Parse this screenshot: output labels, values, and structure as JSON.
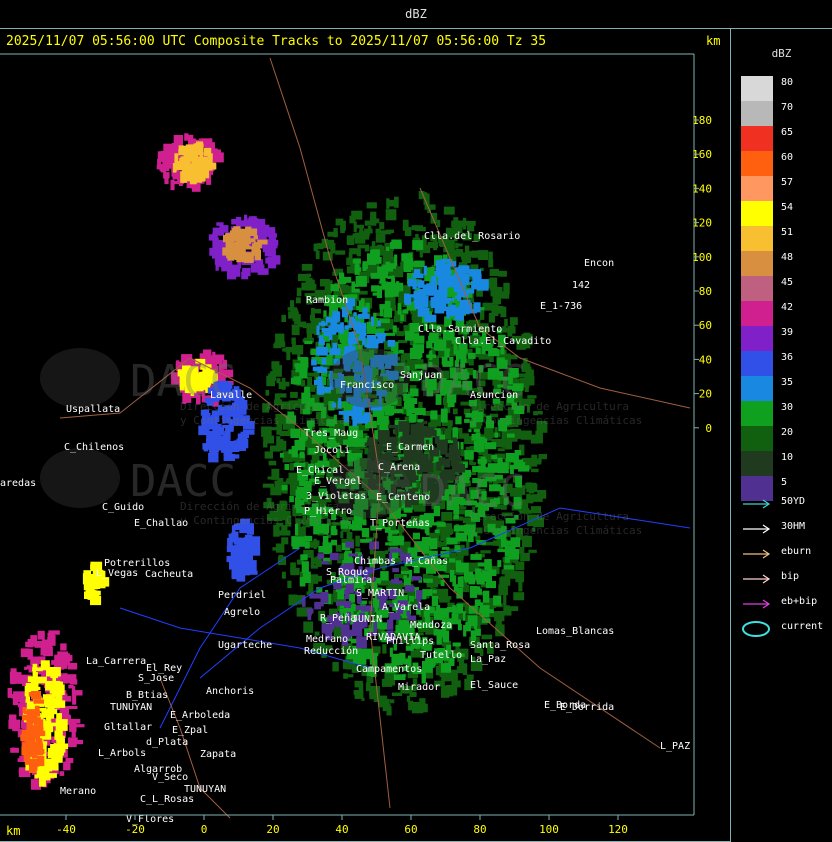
{
  "top_title": "dBZ",
  "header": "2025/11/07 05:56:00 UTC Composite Tracks to 2025/11/07 05:56:00 Tz 35",
  "km_label": "km",
  "y_axis_ticks": [
    "180",
    "160",
    "140",
    "120",
    "100",
    "80",
    "60",
    "40",
    "20",
    "0"
  ],
  "x_axis_ticks": [
    "-40",
    "-20",
    "0",
    "20",
    "40",
    "60",
    "80",
    "100",
    "120"
  ],
  "colorbar": {
    "title": "dBZ",
    "bins": [
      {
        "label": "80",
        "color": "#d8d8d8"
      },
      {
        "label": "70",
        "color": "#b8b8b8"
      },
      {
        "label": "65",
        "color": "#f03020"
      },
      {
        "label": "60",
        "color": "#ff6010"
      },
      {
        "label": "57",
        "color": "#ff9860"
      },
      {
        "label": "54",
        "color": "#ffff00"
      },
      {
        "label": "51",
        "color": "#f8c030"
      },
      {
        "label": "48",
        "color": "#d89040"
      },
      {
        "label": "45",
        "color": "#c06080"
      },
      {
        "label": "42",
        "color": "#d02090"
      },
      {
        "label": "39",
        "color": "#8020c8"
      },
      {
        "label": "36",
        "color": "#3050e8"
      },
      {
        "label": "35",
        "color": "#1888e0"
      },
      {
        "label": "30",
        "color": "#10a020"
      },
      {
        "label": "20",
        "color": "#106010"
      },
      {
        "label": "10",
        "color": "#203a20"
      },
      {
        "label": "5",
        "color": "#503090"
      }
    ]
  },
  "legend": [
    {
      "label": "50YD",
      "color": "#40d0d0"
    },
    {
      "label": "30HM",
      "color": "#ffffff"
    },
    {
      "label": "eburn",
      "color": "#f0c080"
    },
    {
      "label": "bip",
      "color": "#ffd0d0"
    },
    {
      "label": "eb+bip",
      "color": "#e040e0"
    },
    {
      "label": "current",
      "color": "#40e0e0"
    }
  ],
  "watermark": {
    "brand": "DACC",
    "line1": "Dirección de Agricultura",
    "line2": "y Contingencias Climáticas"
  },
  "places": [
    {
      "name": "Clla.del_Rosario"
    },
    {
      "name": "Encon"
    },
    {
      "name": "142"
    },
    {
      "name": "E_1-736"
    },
    {
      "name": "Rambion"
    },
    {
      "name": "Clla.Sarmiento"
    },
    {
      "name": "Clla.El_Cavadito"
    },
    {
      "name": "Uspallata"
    },
    {
      "name": "C_Chilenos"
    },
    {
      "name": "aredas"
    },
    {
      "name": "C_Guido"
    },
    {
      "name": "E_Challao"
    },
    {
      "name": "Tres_Maug"
    },
    {
      "name": "Jocoli"
    },
    {
      "name": "E_Carmen"
    },
    {
      "name": "E_Chical"
    },
    {
      "name": "E_Vergel"
    },
    {
      "name": "C_Arena"
    },
    {
      "name": "3_Violetas"
    },
    {
      "name": "E_Centeno"
    },
    {
      "name": "P_Hierro"
    },
    {
      "name": "T_Porteñas"
    },
    {
      "name": "Potrerillos"
    },
    {
      "name": "L_Vegas"
    },
    {
      "name": "Cacheuta"
    },
    {
      "name": "Perdriel"
    },
    {
      "name": "Chimbas"
    },
    {
      "name": "M_Cañas"
    },
    {
      "name": "Palmira"
    },
    {
      "name": "S_Roque"
    },
    {
      "name": "S_MARTIN"
    },
    {
      "name": "Agrelo"
    },
    {
      "name": "A_Varela"
    },
    {
      "name": "R_Peña"
    },
    {
      "name": "JUNIN"
    },
    {
      "name": "Medrano"
    },
    {
      "name": "RIVADAVIA"
    },
    {
      "name": "Phillips"
    },
    {
      "name": "Ugarteche"
    },
    {
      "name": "Reducción"
    },
    {
      "name": "Lomas_Blancas"
    },
    {
      "name": "La_Carrera"
    },
    {
      "name": "El_Rey"
    },
    {
      "name": "S_Jose"
    },
    {
      "name": "Anchoris"
    },
    {
      "name": "Campamentos"
    },
    {
      "name": "La_Paz"
    },
    {
      "name": "Mirador"
    },
    {
      "name": "E_Borda"
    },
    {
      "name": "TUNUYAN"
    },
    {
      "name": "B_Btias"
    },
    {
      "name": "E_Arboleda"
    },
    {
      "name": "Gltallar"
    },
    {
      "name": "E_Zpal"
    },
    {
      "name": "d_Plata"
    },
    {
      "name": "L_Arbols"
    },
    {
      "name": "Zapata"
    },
    {
      "name": "Algarrob"
    },
    {
      "name": "V_Seco"
    },
    {
      "name": "TUNUYAN"
    },
    {
      "name": "C_L_Rosas"
    },
    {
      "name": "V_Flores"
    },
    {
      "name": "E_Dorrida"
    },
    {
      "name": "L_PAZ"
    },
    {
      "name": "Merano"
    },
    {
      "name": "Santa_Rosa"
    },
    {
      "name": "Tutello"
    },
    {
      "name": "El_Sauce"
    },
    {
      "name": "Sanjuan"
    },
    {
      "name": "Francisco"
    },
    {
      "name": "Asuncion"
    },
    {
      "name": "Lavalle"
    },
    {
      "name": "Mendoza"
    }
  ]
}
